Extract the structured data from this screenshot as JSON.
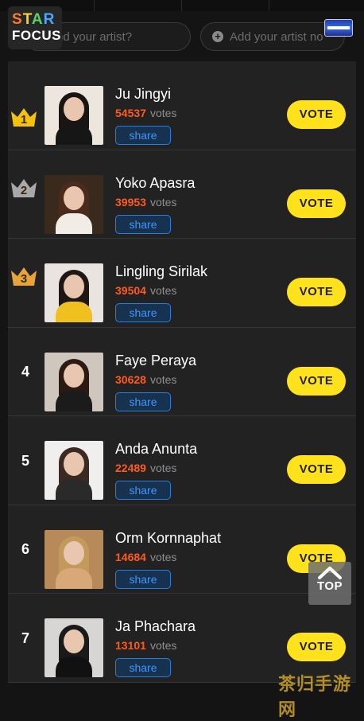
{
  "app": {
    "logo_line1": "STAR",
    "logo_line2": "FOCUS"
  },
  "search": {
    "find_placeholder": "nd your artist?",
    "add_label": "Add your artist no"
  },
  "colors": {
    "vote_button": "#ffe11c",
    "vote_count": "#ff5a1f",
    "share": "#3d96ff",
    "gold": "#f4c20d",
    "silver": "#a8a8a8",
    "bronze": "#e8a33a"
  },
  "artists": [
    {
      "rank": "1",
      "medal": "gold",
      "name": "Ju Jingyi",
      "votes": "54537",
      "votes_label": "votes",
      "share": "share",
      "vote": "VOTE",
      "photo": {
        "bg": "#ede6df",
        "hair": "#1a1412",
        "body": "#161616"
      }
    },
    {
      "rank": "2",
      "medal": "silver",
      "name": "Yoko Apasra",
      "votes": "39953",
      "votes_label": "votes",
      "share": "share",
      "vote": "VOTE",
      "photo": {
        "bg": "#3a2a1e",
        "hair": "#4a2b1c",
        "body": "#f2ece6"
      }
    },
    {
      "rank": "3",
      "medal": "bronze",
      "name": "Lingling Sirilak",
      "votes": "39504",
      "votes_label": "votes",
      "share": "share",
      "vote": "VOTE",
      "photo": {
        "bg": "#e9e4df",
        "hair": "#1f1714",
        "body": "#f0c020"
      }
    },
    {
      "rank": "4",
      "medal": "",
      "name": "Faye Peraya",
      "votes": "30628",
      "votes_label": "votes",
      "share": "share",
      "vote": "VOTE",
      "photo": {
        "bg": "#cfc7bd",
        "hair": "#2a1a12",
        "body": "#1b1b1b"
      }
    },
    {
      "rank": "5",
      "medal": "",
      "name": "Anda Anunta",
      "votes": "22489",
      "votes_label": "votes",
      "share": "share",
      "vote": "VOTE",
      "photo": {
        "bg": "#f1efee",
        "hair": "#3b2a22",
        "body": "#2a2a2a"
      }
    },
    {
      "rank": "6",
      "medal": "",
      "name": "Orm Kornnaphat",
      "votes": "14684",
      "votes_label": "votes",
      "share": "share",
      "vote": "VOTE",
      "photo": {
        "bg": "#b88a5a",
        "hair": "#c49a5c",
        "body": "#d8a878"
      }
    },
    {
      "rank": "7",
      "medal": "",
      "name": "Ja Phachara",
      "votes": "13101",
      "votes_label": "votes",
      "share": "share",
      "vote": "VOTE",
      "photo": {
        "bg": "#d8d6d4",
        "hair": "#1a1a1a",
        "body": "#111111"
      }
    }
  ],
  "scroll_top": {
    "label": "TOP"
  },
  "watermark": "茶归手游网"
}
